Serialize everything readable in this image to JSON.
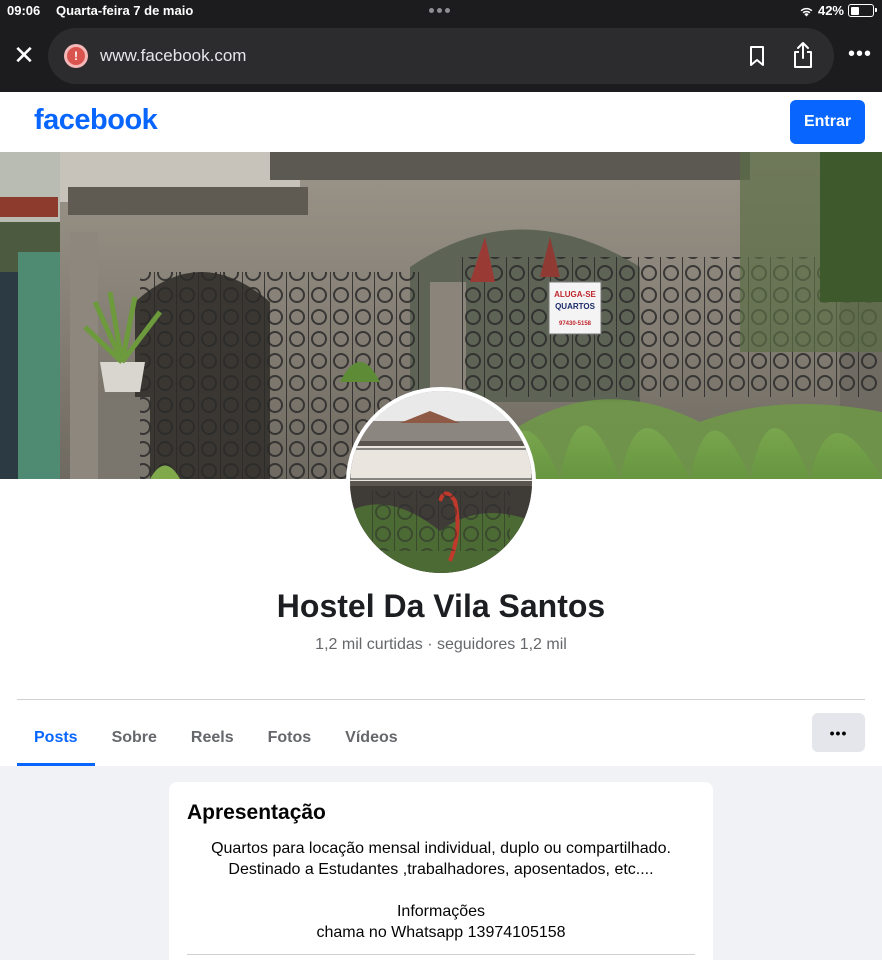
{
  "status_bar": {
    "time": "09:06",
    "date": "Quarta-feira 7 de maio",
    "battery": "42%",
    "battery_level": 0.42
  },
  "browser": {
    "url": "www.facebook.com",
    "close_icon": "close-icon",
    "warning_icon": "warning-icon"
  },
  "header": {
    "logo": "facebook",
    "login_label": "Entrar",
    "brand_color": "#0866ff"
  },
  "cover": {
    "sign_lines": [
      "ALUGA-SE",
      "QUARTOS",
      "97430-5158"
    ]
  },
  "page": {
    "name": "Hostel Da Vila Santos",
    "stats": "1,2 mil curtidas · seguidores 1,2 mil"
  },
  "tabs": [
    {
      "label": "Posts",
      "active": true
    },
    {
      "label": "Sobre",
      "active": false
    },
    {
      "label": "Reels",
      "active": false
    },
    {
      "label": "Fotos",
      "active": false
    },
    {
      "label": "Vídeos",
      "active": false
    }
  ],
  "tabs_more": "•••",
  "intro": {
    "title": "Apresentação",
    "lines": [
      "Quartos para locação mensal individual, duplo ou compartilhado.",
      "Destinado a Estudantes ,trabalhadores, aposentados, etc....",
      "",
      "Informações",
      "chama no Whatsapp 13974105158"
    ]
  }
}
